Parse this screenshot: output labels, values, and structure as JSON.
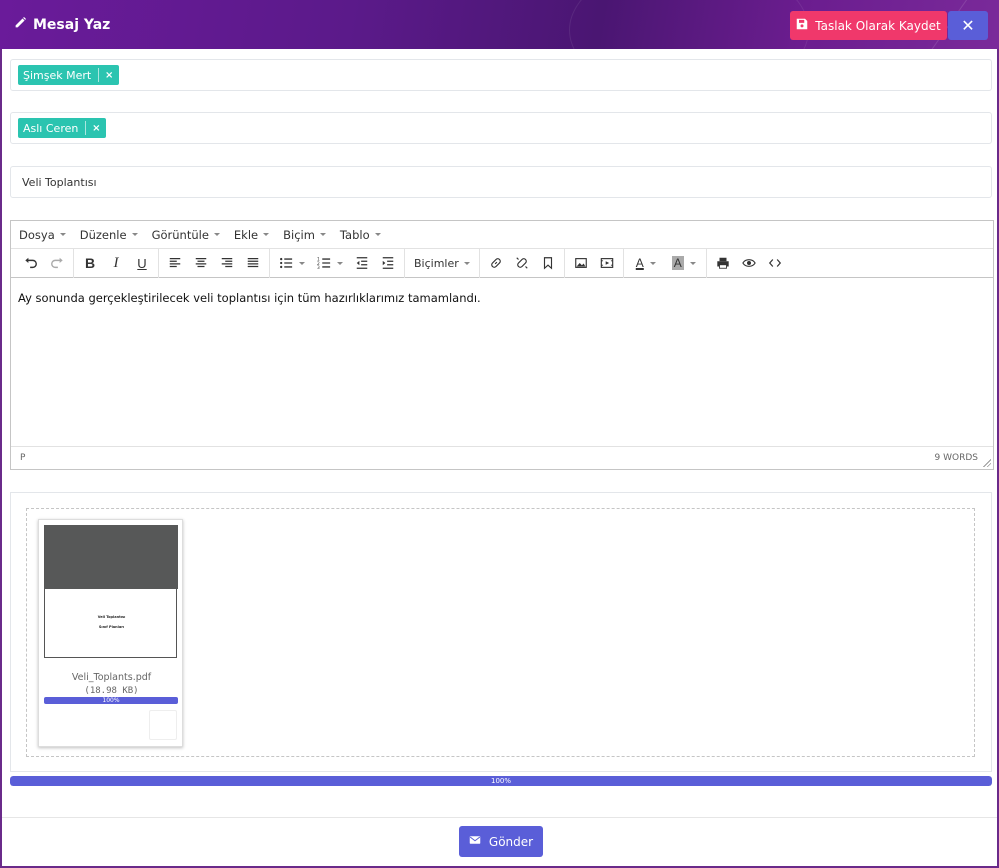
{
  "header": {
    "title": "Mesaj Yaz",
    "draft_label": "Taslak Olarak Kaydet",
    "close_label": "✕",
    "gradient_color": "#6a1b9a"
  },
  "recipients": [
    {
      "name": "Şimşek Mert"
    }
  ],
  "cc": [
    {
      "name": "Aslı Ceren"
    }
  ],
  "subject": {
    "value": "Veli Toplantısı"
  },
  "editor": {
    "menu": [
      "Dosya",
      "Düzenle",
      "Görüntüle",
      "Ekle",
      "Biçim",
      "Tablo"
    ],
    "formats_label": "Biçimler",
    "content": "Ay sonunda gerçekleştirilecek veli toplantısı için tüm hazırlıklarımız tamamlandı.",
    "status_path": "P",
    "word_count": "9 WORDS"
  },
  "attachment": {
    "file_name": "Veli_Toplants.pdf",
    "file_size": "(18.98 KB)",
    "progress_label": "100%",
    "progress_value": 100,
    "thumb_line1": "Veli Toplantısı",
    "thumb_line2": "Sınıf Planları"
  },
  "total_progress": {
    "label": "100%",
    "value": 100
  },
  "footer": {
    "send_label": "Gönder"
  },
  "colors": {
    "accent": "#5a5ed8",
    "danger": "#f0386b",
    "tag": "#2bc4b0"
  }
}
